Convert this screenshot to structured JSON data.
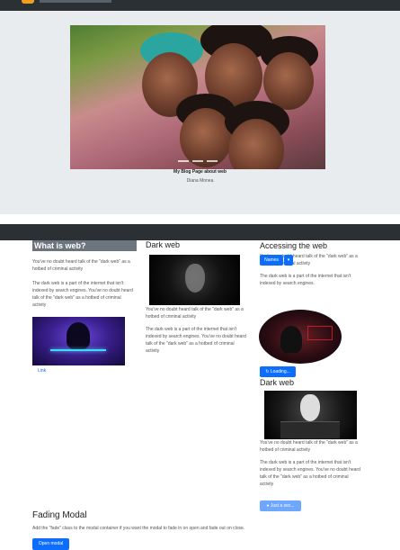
{
  "hero": {
    "caption": "My Blog Page about web",
    "author": "Diana Monea"
  },
  "col1": {
    "title": "What is web?",
    "p1": "You've no doubt heard talk of the \"dark web\" as a hotbed of criminal activity",
    "p2": "The dark web is a part of the internet that isn't indexed by search engines. You've no doubt heard talk of the \"dark web\" as a hotbed of criminal activity",
    "link": "Link"
  },
  "col2": {
    "title": "Dark web",
    "p1": "You've no doubt heard talk of the \"dark web\" as a hotbed of criminal activity",
    "p2": "The dark web is a part of the internet that isn't indexed by search engines. You've no doubt heard talk of the \"dark web\" as a hotbed of criminal activity"
  },
  "col3": {
    "title": "Accessing the web",
    "p1": "You've no doubt heard talk of the \"dark web\" as a hotbed of criminal activity",
    "p2": "The dark web is a part of the internet that isn't indexed by search engines.",
    "names_button": "Names",
    "loading_button": "Loading...",
    "title2": "Dark web",
    "p3": "You've no doubt heard talk of the \"dark web\" as a hotbed of criminal activity",
    "p4": "The dark web is a part of the internet that isn't indexed by search engines. You've no doubt heard talk of the \"dark web\" as a hotbed of criminal activity",
    "sec_button": "Just a sec..."
  },
  "modal": {
    "title": "Fading Modal",
    "desc": "Add the \"fade\" class to the modal container if you want the modal to fade in on open and fade out on close.",
    "button": "Open modal"
  },
  "colors": {
    "navbar": "#2b3035",
    "hero_bg": "#e9ecef",
    "primary": "#0d6efd"
  }
}
